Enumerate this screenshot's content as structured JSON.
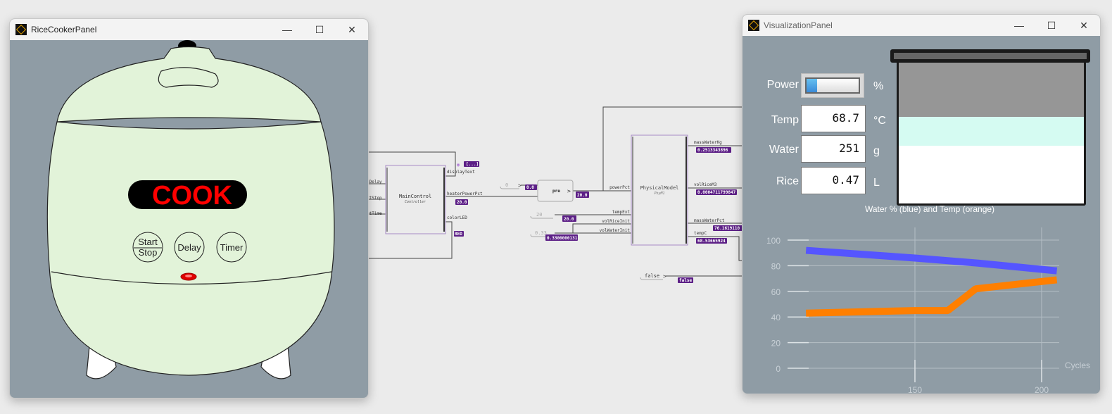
{
  "rice_cooker_window": {
    "title": "RiceCookerPanel",
    "display_text": "COOK",
    "display_color": "#ff0000",
    "buttons": {
      "start": "Start",
      "stop": "Stop",
      "delay": "Delay",
      "timer": "Timer"
    },
    "led_color": "#e00000",
    "body_color": "#e2f3d9"
  },
  "diagram": {
    "main_control": {
      "name": "MainControl",
      "type": "Controller",
      "inputs": [
        "nDelay",
        "rtStop",
        "atTime"
      ],
      "outputs": {
        "display_text": "displayText",
        "heater_power_pct": "heaterPowerPct",
        "color_led": "colorLED"
      },
      "values": {
        "display_text": "[...]",
        "heater_power_pct": "20.0",
        "color_led": "RED"
      }
    },
    "pre": {
      "name": "pre",
      "const_input": "0",
      "const_value": "0.0",
      "output_value": "20.0"
    },
    "physical_model": {
      "name": "PhysicalModel",
      "type": "PhyM1",
      "inputs": {
        "power_pct": "powerPct",
        "temp_ext": "tempExt",
        "vol_rice_init": "volRiceInit",
        "vol_water_init": "volWaterInit"
      },
      "outputs": {
        "mass_water_kg": "massWaterKg",
        "vol_rice_m3": "volRiceM3",
        "mass_water_pct": "massWaterPct",
        "temp_c": "tempC"
      },
      "values": {
        "mass_water_kg": "0.2513343896",
        "vol_rice_m3": "0.0004711799847",
        "mass_water_pct": "76.1619110",
        "temp_c": "68.53665924"
      }
    },
    "consts": {
      "temp_ext": "20",
      "temp_ext_value": "20.0",
      "vol": "0.33",
      "vol_value": "0.3300000131",
      "flag": "false",
      "flag_value": "false"
    }
  },
  "viz_window": {
    "title": "VisualizationPanel",
    "power": {
      "label": "Power",
      "unit": "%",
      "level": 0.2
    },
    "temp": {
      "label": "Temp",
      "value": "68.7",
      "unit": "°C"
    },
    "water": {
      "label": "Water",
      "value": "251",
      "unit": "g"
    },
    "rice": {
      "label": "Rice",
      "value": "0.47",
      "unit": "L"
    },
    "pot_colors": {
      "rice": "#ffffff",
      "water": "#d5fbf2",
      "empty": "#969696"
    }
  },
  "chart_data": {
    "type": "line",
    "title": "Water % (blue) and Temp (orange)",
    "xlabel": "Cycles",
    "xlim": [
      107,
      207
    ],
    "ylim": [
      0,
      100
    ],
    "xticks": [
      150,
      200
    ],
    "yticks": [
      0,
      20,
      40,
      60,
      80,
      100
    ],
    "grid": true,
    "series": [
      {
        "color": "#5555ff",
        "x": [
          107,
          150,
          175,
          206
        ],
        "y": [
          92,
          86,
          82,
          76
        ]
      },
      {
        "color": "#ff7f00",
        "x": [
          107,
          150,
          163,
          174,
          206
        ],
        "y": [
          43,
          45,
          45,
          62,
          69
        ]
      }
    ]
  }
}
